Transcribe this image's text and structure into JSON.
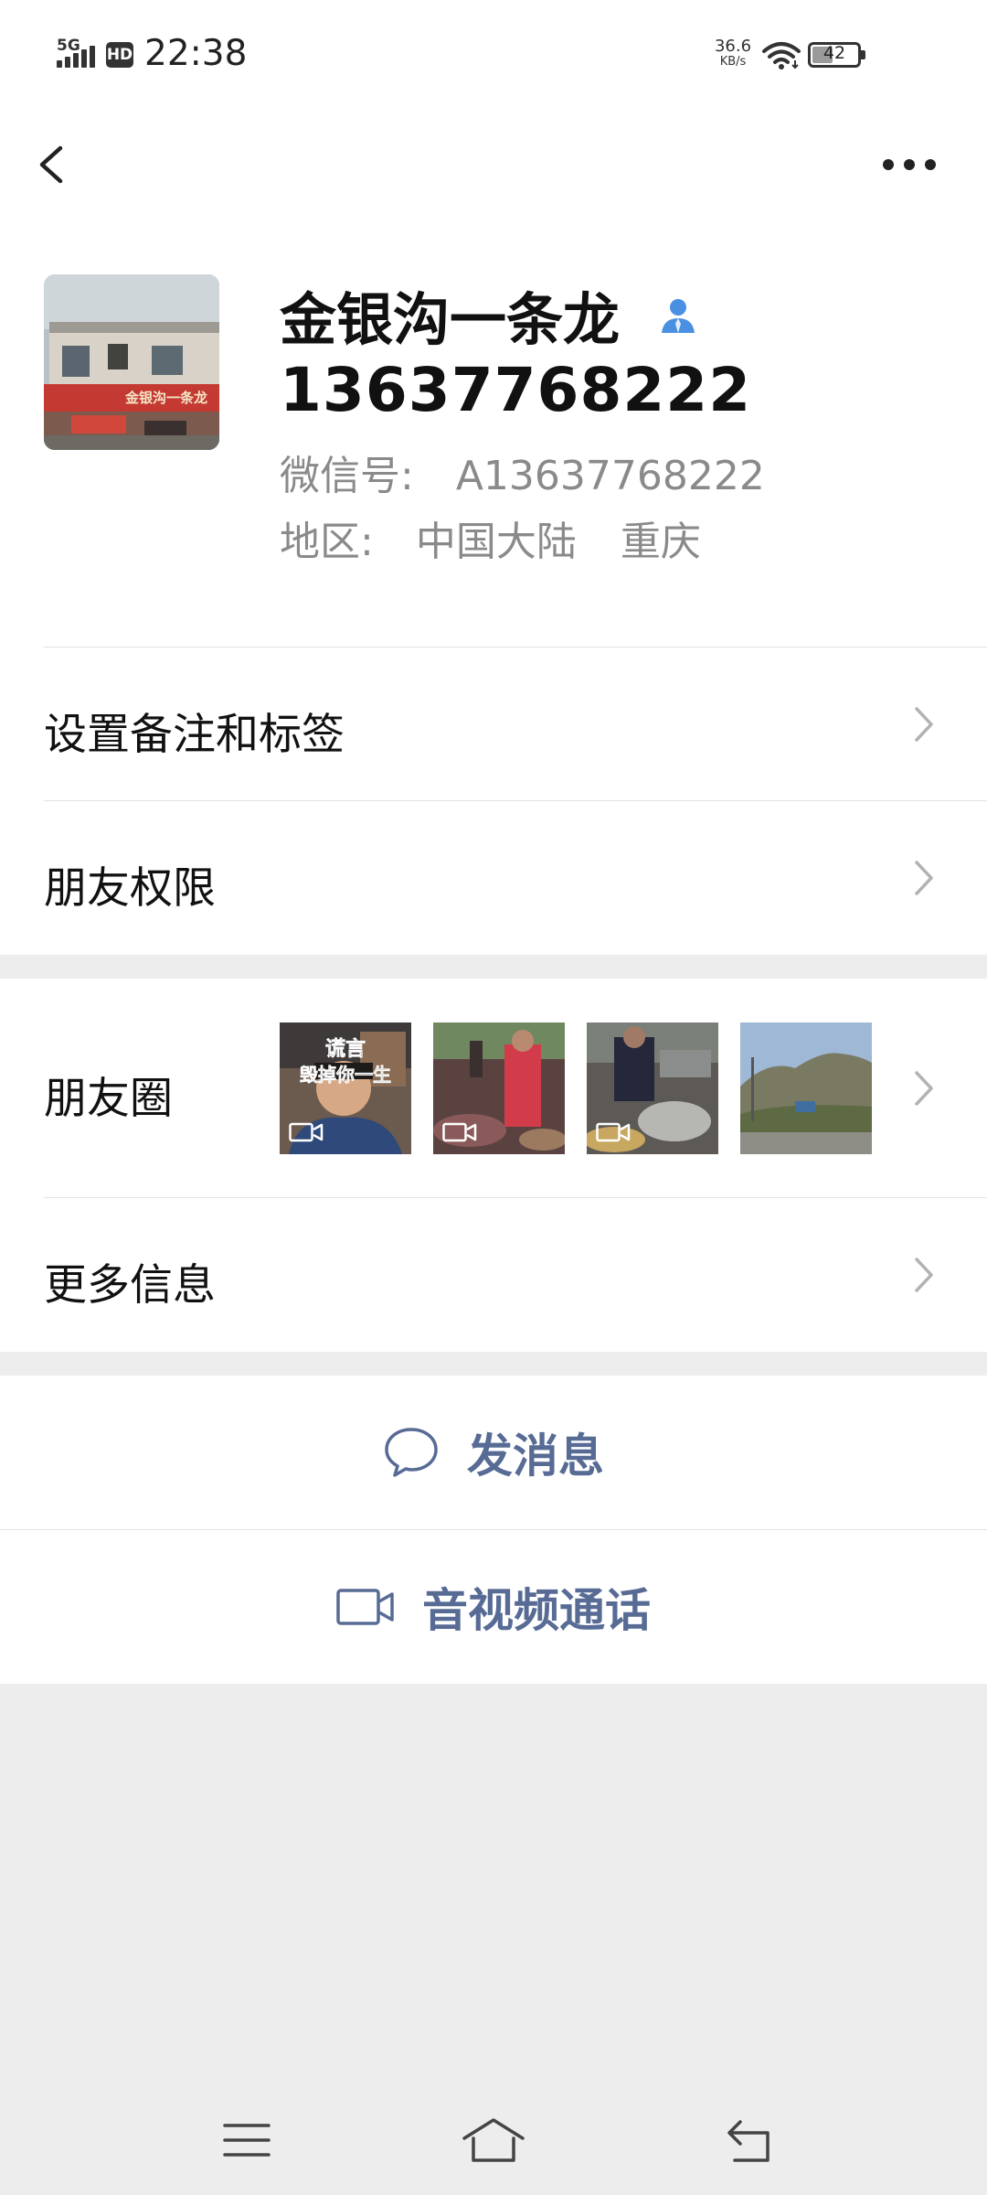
{
  "status_bar": {
    "network": "5G",
    "hd": "HD",
    "time": "22:38",
    "speed_value": "36.6",
    "speed_unit": "KB/s",
    "battery": "42",
    "battery_level": 0.42
  },
  "nav": {
    "back_icon": "chevron-left-icon",
    "more_icon": "ellipsis-icon"
  },
  "profile": {
    "name": "金银沟一条龙",
    "phone": "13637768222",
    "wechat_label": "微信号:",
    "wechat_id": "A13637768222",
    "region_label": "地区:",
    "region_country": "中国大陆",
    "region_city": "重庆",
    "avatar_sign_text": "金银沟一条龙"
  },
  "menu": {
    "set_remark": "设置备注和标签",
    "friend_permission": "朋友权限",
    "moments": "朋友圈",
    "more_info": "更多信息"
  },
  "moments_thumbs": [
    {
      "caption_line1": "谎言",
      "caption_line2": "毁掉你一生",
      "is_video": true
    },
    {
      "is_video": true
    },
    {
      "is_video": true
    },
    {
      "is_video": false
    }
  ],
  "actions": {
    "send_message": "发消息",
    "av_call": "音视频通话"
  },
  "colors": {
    "accent": "#576b95",
    "background": "#ededed",
    "person_icon": "#4a90e2"
  }
}
